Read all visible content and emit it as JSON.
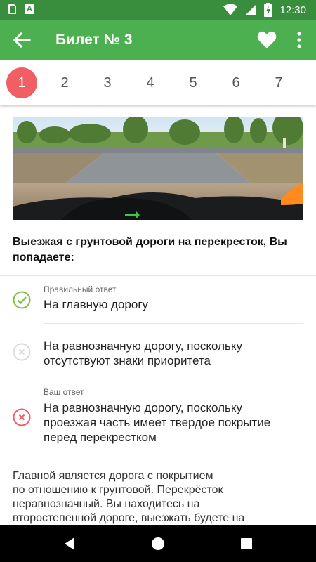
{
  "status_bar": {
    "time": "12:30",
    "icons": [
      "sd-card-icon",
      "a-notification-icon",
      "wifi-icon",
      "signal-icon",
      "battery-charging-icon"
    ]
  },
  "app_bar": {
    "title": "Билет № 3",
    "icons": [
      "back-arrow-icon",
      "heart-icon",
      "more-vert-icon"
    ]
  },
  "tabs": [
    {
      "label": "1",
      "active": true
    },
    {
      "label": "2",
      "active": false
    },
    {
      "label": "3",
      "active": false
    },
    {
      "label": "4",
      "active": false
    },
    {
      "label": "5",
      "active": false
    },
    {
      "label": "6",
      "active": false
    },
    {
      "label": "7",
      "active": false
    }
  ],
  "question": {
    "text": "Выезжая с грунтовой дороги на перекресток, Вы попадаете:"
  },
  "answers": [
    {
      "hint": "Правильный ответ",
      "lines": [
        "На главную дорогу"
      ],
      "state": "correct",
      "icon": "check-circle-icon"
    },
    {
      "hint": "",
      "lines": [
        "На равнозначную дорогу, поскольку",
        "отсутствуют знаки приоритета"
      ],
      "state": "neutral",
      "icon": "x-circle-icon"
    },
    {
      "hint": "Ваш ответ",
      "lines": [
        "На равнозначную дорогу, поскольку",
        "проезжая часть имеет твердое покрытие",
        "перед перекрестком"
      ],
      "state": "wrong",
      "icon": "x-circle-icon"
    }
  ],
  "explanation": {
    "lines": [
      "Главной является дорога с покрытием",
      "по отношению к грунтовой. Перекрёсток",
      "неравнозначный. Вы находитесь на",
      "второстепенной дороге, выезжать будете на"
    ]
  },
  "nav_bar": {
    "icons": [
      "back-triangle-icon",
      "home-circle-icon",
      "recents-square-icon"
    ]
  },
  "colors": {
    "status_bar": "#388e3c",
    "app_bar": "#4caf50",
    "active_tab": "#ef5f63",
    "correct": "#7cc242",
    "wrong": "#ef5f63",
    "neutral": "#d8d8d8"
  }
}
